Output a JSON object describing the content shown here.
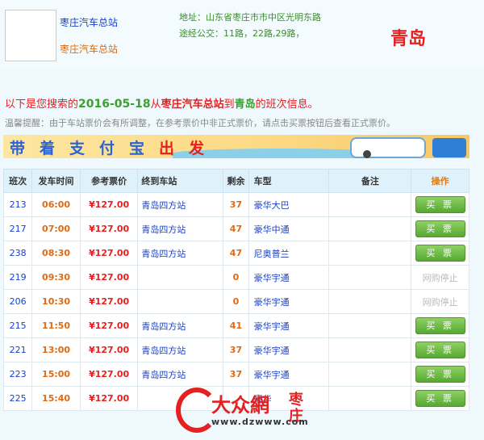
{
  "header": {
    "station_name": "枣庄汽车总站",
    "station_sub": "枣庄汽车总站",
    "address": "地址：山东省枣庄市市中区光明东路",
    "bus_routes": "途经公交：11路，22路,29路，",
    "destination": "青岛"
  },
  "search": {
    "prefix": "以下是您搜索的",
    "date": "2016-05-18",
    "from_word": "从",
    "from": "枣庄汽车总站",
    "to_word": "到",
    "to": "青岛",
    "suffix": "的班次信息。"
  },
  "tip": "温馨提醒：由于车站票价会有所调整，在参考票价中非正式票价，请点击买票按钮后查看正式票价。",
  "banner": {
    "text_a": "带着支付宝",
    "text_b": "出",
    "text_c": "发"
  },
  "table": {
    "headers": [
      "班次",
      "发车时间",
      "参考票价",
      "终到车站",
      "剩余",
      "车型",
      "备注",
      "操作"
    ],
    "rows": [
      {
        "id": "213",
        "time": "06:00",
        "price": "¥127.00",
        "terminal": "青岛四方站",
        "left": "37",
        "type": "豪华大巴",
        "note": "",
        "op": "买 票",
        "buyable": true
      },
      {
        "id": "217",
        "time": "07:00",
        "price": "¥127.00",
        "terminal": "青岛四方站",
        "left": "47",
        "type": "豪华中通",
        "note": "",
        "op": "买 票",
        "buyable": true
      },
      {
        "id": "238",
        "time": "08:30",
        "price": "¥127.00",
        "terminal": "青岛四方站",
        "left": "47",
        "type": "尼奥普兰",
        "note": "",
        "op": "买 票",
        "buyable": true
      },
      {
        "id": "219",
        "time": "09:30",
        "price": "¥127.00",
        "terminal": "",
        "left": "0",
        "type": "豪华宇通",
        "note": "",
        "op": "网购停止",
        "buyable": false
      },
      {
        "id": "206",
        "time": "10:30",
        "price": "¥127.00",
        "terminal": "",
        "left": "0",
        "type": "豪华宇通",
        "note": "",
        "op": "网购停止",
        "buyable": false
      },
      {
        "id": "215",
        "time": "11:50",
        "price": "¥127.00",
        "terminal": "青岛四方站",
        "left": "41",
        "type": "豪华宇通",
        "note": "",
        "op": "买 票",
        "buyable": true
      },
      {
        "id": "221",
        "time": "13:00",
        "price": "¥127.00",
        "terminal": "青岛四方站",
        "left": "37",
        "type": "豪华宇通",
        "note": "",
        "op": "买 票",
        "buyable": true
      },
      {
        "id": "223",
        "time": "15:00",
        "price": "¥127.00",
        "terminal": "青岛四方站",
        "left": "37",
        "type": "豪华宇通",
        "note": "",
        "op": "买 票",
        "buyable": true
      },
      {
        "id": "225",
        "time": "15:40",
        "price": "¥127.00",
        "terminal": "",
        "left": "",
        "type": "豪华",
        "note": "",
        "op": "买 票",
        "buyable": true
      }
    ]
  },
  "watermark": {
    "title": "大众網",
    "city": "枣庄",
    "url": "www.dzwww.com"
  },
  "colors": {
    "accent_red": "#e52020",
    "accent_green": "#3aa12f",
    "link_blue": "#1a40c8",
    "orange": "#e06a14"
  }
}
